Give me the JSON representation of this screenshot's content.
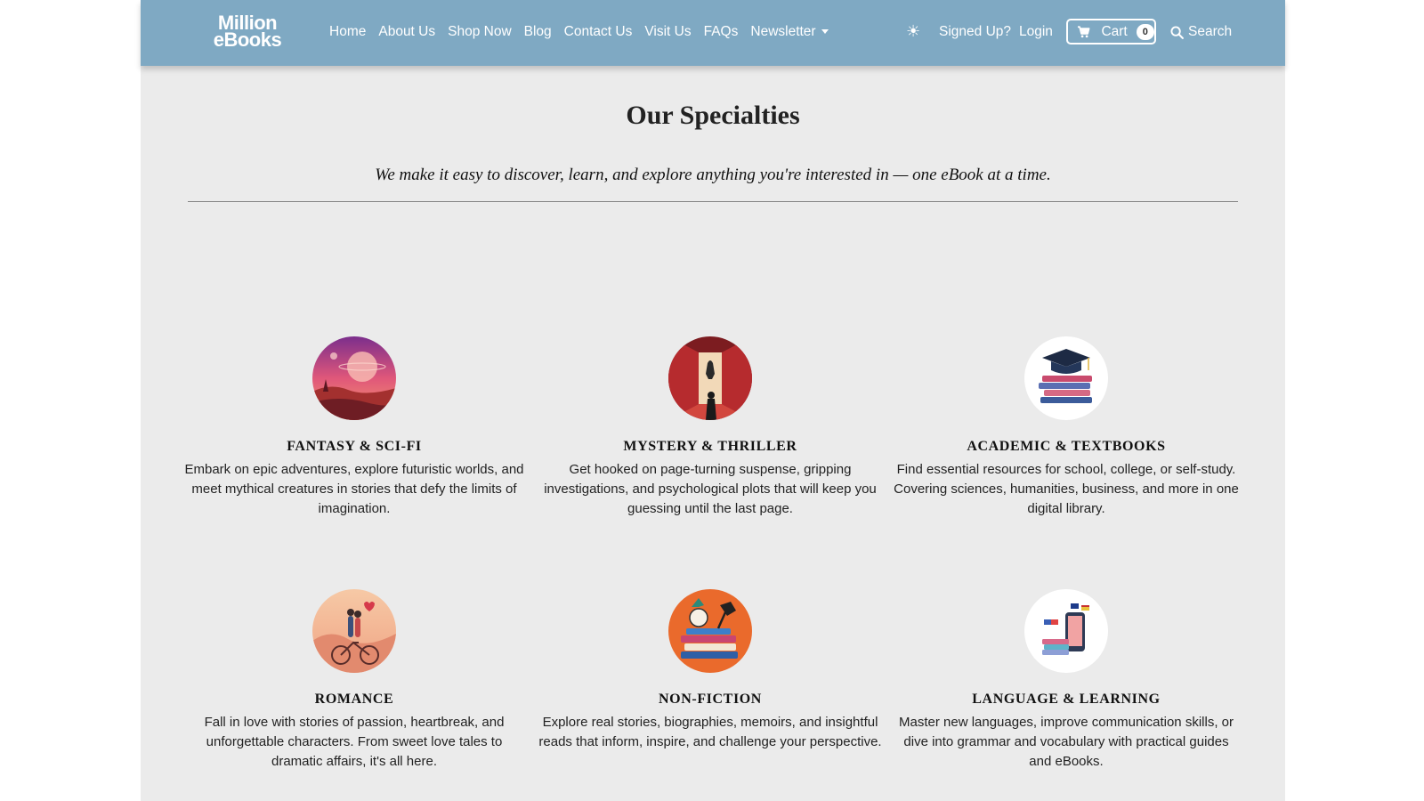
{
  "nav": {
    "logo_line1": "Million",
    "logo_line2": "eBooks",
    "links": [
      "Home",
      "About Us",
      "Shop Now",
      "Blog",
      "Contact Us",
      "Visit Us",
      "FAQs",
      "Newsletter"
    ],
    "theme_icon": "sun-icon",
    "signed_up": "Signed Up?",
    "login": "Login",
    "cart_label": "Cart",
    "cart_count": "0",
    "search_label": "Search"
  },
  "main": {
    "title": "Our Specialties",
    "subtitle": "We make it easy to discover, learn, and explore anything you're interested in — one eBook at a time.",
    "cards": [
      {
        "title": "FANTASY & SCI-FI",
        "desc": "Embark on epic adventures, explore futuristic worlds, and meet mythical creatures in stories that defy the limits of imagination.",
        "icon": "fantasy-planet-icon"
      },
      {
        "title": "MYSTERY & THRILLER",
        "desc": "Get hooked on page-turning suspense, gripping investigations, and psychological plots that will keep you guessing until the last page.",
        "icon": "mystery-corridor-icon"
      },
      {
        "title": "ACADEMIC & TEXTBOOKS",
        "desc": "Find essential resources for school, college, or self-study. Covering sciences, humanities, business, and more in one digital library.",
        "icon": "graduation-books-icon"
      },
      {
        "title": "ROMANCE",
        "desc": "Fall in love with stories of passion, heartbreak, and unforgettable characters. From sweet love tales to dramatic affairs, it's all here.",
        "icon": "couple-bicycle-icon"
      },
      {
        "title": "NON-FICTION",
        "desc": "Explore real stories, biographies, memoirs, and insightful reads that inform, inspire, and challenge your perspective.",
        "icon": "book-stack-lamp-icon"
      },
      {
        "title": "LANGUAGE & LEARNING",
        "desc": "Master new languages, improve communication skills, or dive into grammar and vocabulary with practical guides and eBooks.",
        "icon": "language-phone-icon"
      }
    ]
  },
  "colors": {
    "navbar": "#7fa9c3",
    "background": "#ebebeb"
  }
}
